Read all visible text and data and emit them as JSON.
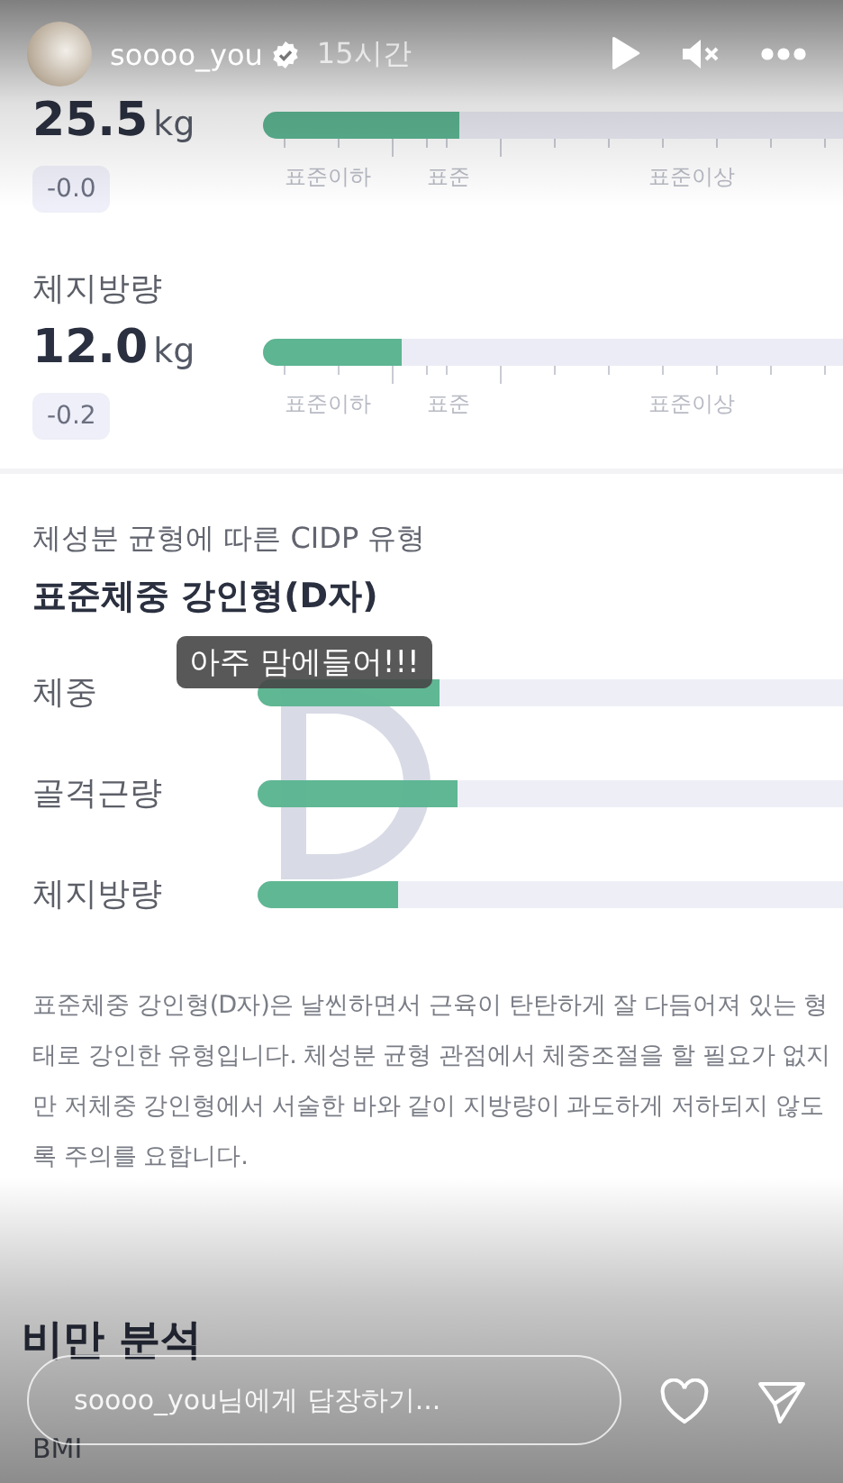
{
  "story": {
    "username": "soooo_you",
    "verified": true,
    "time": "15시간",
    "muted": true
  },
  "metrics": [
    {
      "value": "25.5",
      "unit": "kg",
      "delta": "-0.0",
      "level": 0.34,
      "scale": [
        "표준이하",
        "표준",
        "표준이상"
      ]
    },
    {
      "label": "체지방량",
      "value": "12.0",
      "unit": "kg",
      "delta": "-0.2",
      "level": 0.24,
      "scale": [
        "표준이하",
        "표준",
        "표준이상"
      ]
    }
  ],
  "cidp": {
    "caption": "체성분 균형에 따른 CIDP 유형",
    "title": "표준체중 강인형(D자)",
    "rows": [
      {
        "label": "체중",
        "level": 0.31
      },
      {
        "label": "골격근량",
        "level": 0.34
      },
      {
        "label": "체지방량",
        "level": 0.24
      }
    ],
    "description": "표준체중 강인형(D자)은 날씬하면서 근육이 탄탄하게 잘 다듬어져 있는 형태로 강인한 유형입니다. 체성분 균형 관점에서 체중조절을 할 필요가 없지만 저체중 강인형에서 서술한 바와 같이 지방량이 과도하게 저하되지 않도록 주의를 요합니다."
  },
  "sticker": {
    "text": "아주 맘에들어!!!"
  },
  "obesity": {
    "title": "비만 분석",
    "item": "BMI"
  },
  "reply": {
    "placeholder": "soooo_you님에게 답장하기..."
  }
}
